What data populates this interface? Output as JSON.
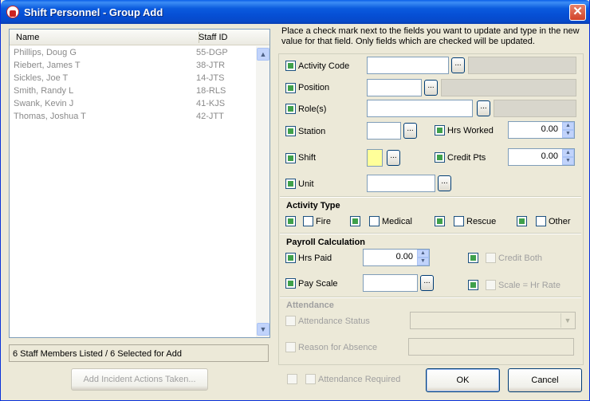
{
  "window": {
    "title": "Shift Personnel - Group Add",
    "close": "✕"
  },
  "staff_list": {
    "col_name": "Name",
    "col_id": "Staff ID",
    "rows": [
      {
        "name": "Phillips, Doug G",
        "id": "55-DGP"
      },
      {
        "name": "Riebert, James T",
        "id": "38-JTR"
      },
      {
        "name": "Sickles, Joe T",
        "id": "14-JTS"
      },
      {
        "name": "Smith, Randy L",
        "id": "18-RLS"
      },
      {
        "name": "Swank, Kevin J",
        "id": "41-KJS"
      },
      {
        "name": "Thomas, Joshua T",
        "id": "42-JTT"
      }
    ],
    "status": "6 Staff Members Listed / 6 Selected for Add"
  },
  "buttons": {
    "add_actions": "Add Incident Actions Taken...",
    "ok": "OK",
    "cancel": "Cancel",
    "ellipsis": "..."
  },
  "instructions": "Place a check mark next to the fields you want to update and type in the new value for that field. Only fields which are checked will be updated.",
  "fields": {
    "activity_code": "Activity Code",
    "position": "Position",
    "roles": "Role(s)",
    "station": "Station",
    "hrs_worked": "Hrs Worked",
    "hrs_worked_value": "0.00",
    "shift": "Shift",
    "credit_pts": "Credit Pts",
    "credit_pts_value": "0.00",
    "unit": "Unit"
  },
  "activity_type": {
    "title": "Activity Type",
    "fire": "Fire",
    "medical": "Medical",
    "rescue": "Rescue",
    "other": "Other"
  },
  "payroll": {
    "title": "Payroll Calculation",
    "hrs_paid": "Hrs Paid",
    "hrs_paid_value": "0.00",
    "credit_both": "Credit Both",
    "pay_scale": "Pay Scale",
    "scale_hr_rate": "Scale = Hr Rate"
  },
  "attendance": {
    "title": "Attendance",
    "status": "Attendance Status",
    "reason": "Reason for Absence",
    "required": "Attendance Required"
  },
  "icons": {
    "app": "app-logo-icon",
    "scroll_up": "▲",
    "scroll_down": "▼",
    "spin_up": "▲",
    "spin_down": "▼",
    "combo": "▼"
  },
  "colors": {
    "title_bar": "#0a5fe8",
    "check_green": "#3fa04b",
    "shift_yellow": "#ffff99"
  }
}
